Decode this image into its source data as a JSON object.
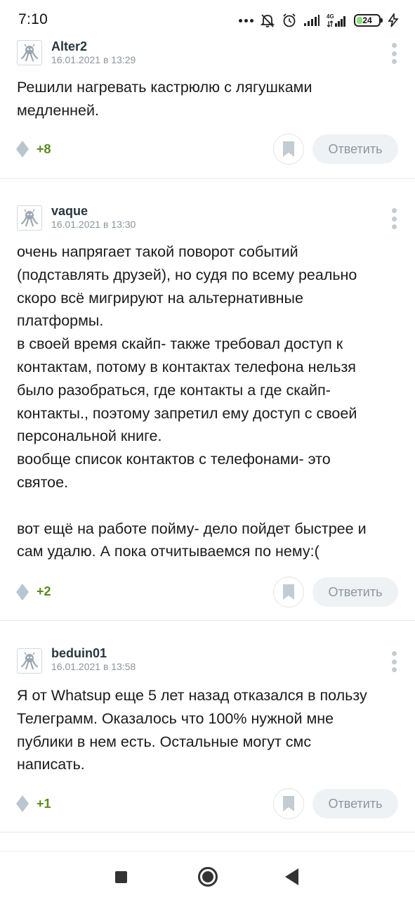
{
  "status_bar": {
    "time": "7:10",
    "battery_percent": "24",
    "network_label": "4G",
    "accent_battery_color": "#8ee07e"
  },
  "comments": [
    {
      "username": "Alter2",
      "datetime": "16.01.2021 в 13:29",
      "text": [
        "Решили нагревать кастрюлю с лягушками",
        "медленней."
      ],
      "rating": "+8",
      "reply_label": "Ответить"
    },
    {
      "username": "vaque",
      "datetime": "16.01.2021 в 13:30",
      "text": [
        "очень напрягает такой поворот событий",
        "(подставлять друзей), но судя по всему реально",
        "скоро всё мигрируют на альтернативные",
        "платформы.",
        "в своей время скайп- также требовал доступ к",
        "контактам, потому в контактах телефона нельзя",
        "было разобраться, где контакты а где скайп-",
        "контакты., поэтому запретил ему доступ с своей",
        "персональной книге.",
        "вообще список контактов с телефонами- это",
        "святое.",
        "",
        "вот ещё на работе пойму- дело пойдет быстрее и",
        "сам удалю. А пока отчитываемся по нему:("
      ],
      "rating": "+2",
      "reply_label": "Ответить"
    },
    {
      "username": "beduin01",
      "datetime": "16.01.2021 в 13:58",
      "text": [
        "Я от Whatsup еще 5 лет назад отказался в пользу",
        "Телеграмм. Оказалось что 100% нужной мне",
        "публики в нем есть. Остальные могут смс",
        "написать."
      ],
      "rating": "+1",
      "reply_label": "Ответить"
    }
  ],
  "icons": {
    "avatar": "octopus-avatar-icon",
    "rating": "rating-diamond-icon",
    "bookmark": "bookmark-icon",
    "more": "more-vertical-icon"
  },
  "colors": {
    "username": "#27363f",
    "rating_positive": "#5a8a1c",
    "reply_button_bg": "#eef2f5",
    "icon_gray": "#b9c6d0"
  }
}
